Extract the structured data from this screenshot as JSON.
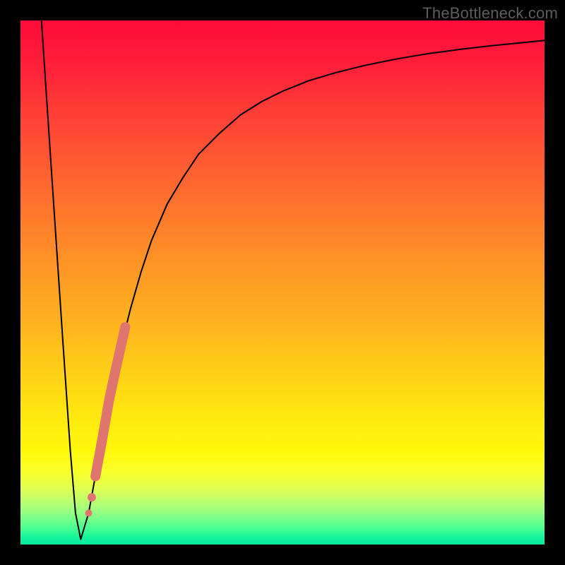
{
  "watermark": "TheBottleneck.com",
  "chart_data": {
    "type": "line",
    "title": "",
    "xlabel": "",
    "ylabel": "",
    "xlim": [
      0,
      100
    ],
    "ylim": [
      0,
      100
    ],
    "grid": false,
    "series": [
      {
        "name": "curve",
        "stroke": "#000000",
        "x": [
          4,
          6,
          8,
          9.5,
          10.5,
          11.5,
          13,
          15,
          17,
          19,
          21,
          23,
          25,
          28,
          31,
          34,
          38,
          42,
          46,
          50,
          55,
          60,
          66,
          72,
          78,
          84,
          90,
          96,
          100
        ],
        "y": [
          100,
          70,
          40,
          18,
          6,
          1,
          6,
          17,
          28,
          37,
          45,
          52,
          58,
          65,
          70,
          74.5,
          78.5,
          82,
          84.5,
          86.5,
          88.5,
          90,
          91.5,
          92.7,
          93.7,
          94.5,
          95.2,
          95.8,
          96.2
        ]
      }
    ],
    "highlight_segment": {
      "name": "pink-beads",
      "stroke": "#e0746e",
      "points": [
        {
          "x": 13.0,
          "y": 6.0
        },
        {
          "x": 13.6,
          "y": 9.0
        },
        {
          "x": 14.3,
          "y": 13.0
        },
        {
          "x": 15.5,
          "y": 19.5
        },
        {
          "x": 17.0,
          "y": 28.0
        },
        {
          "x": 18.3,
          "y": 34.0
        },
        {
          "x": 19.2,
          "y": 38.0
        },
        {
          "x": 20.0,
          "y": 41.5
        }
      ]
    }
  }
}
